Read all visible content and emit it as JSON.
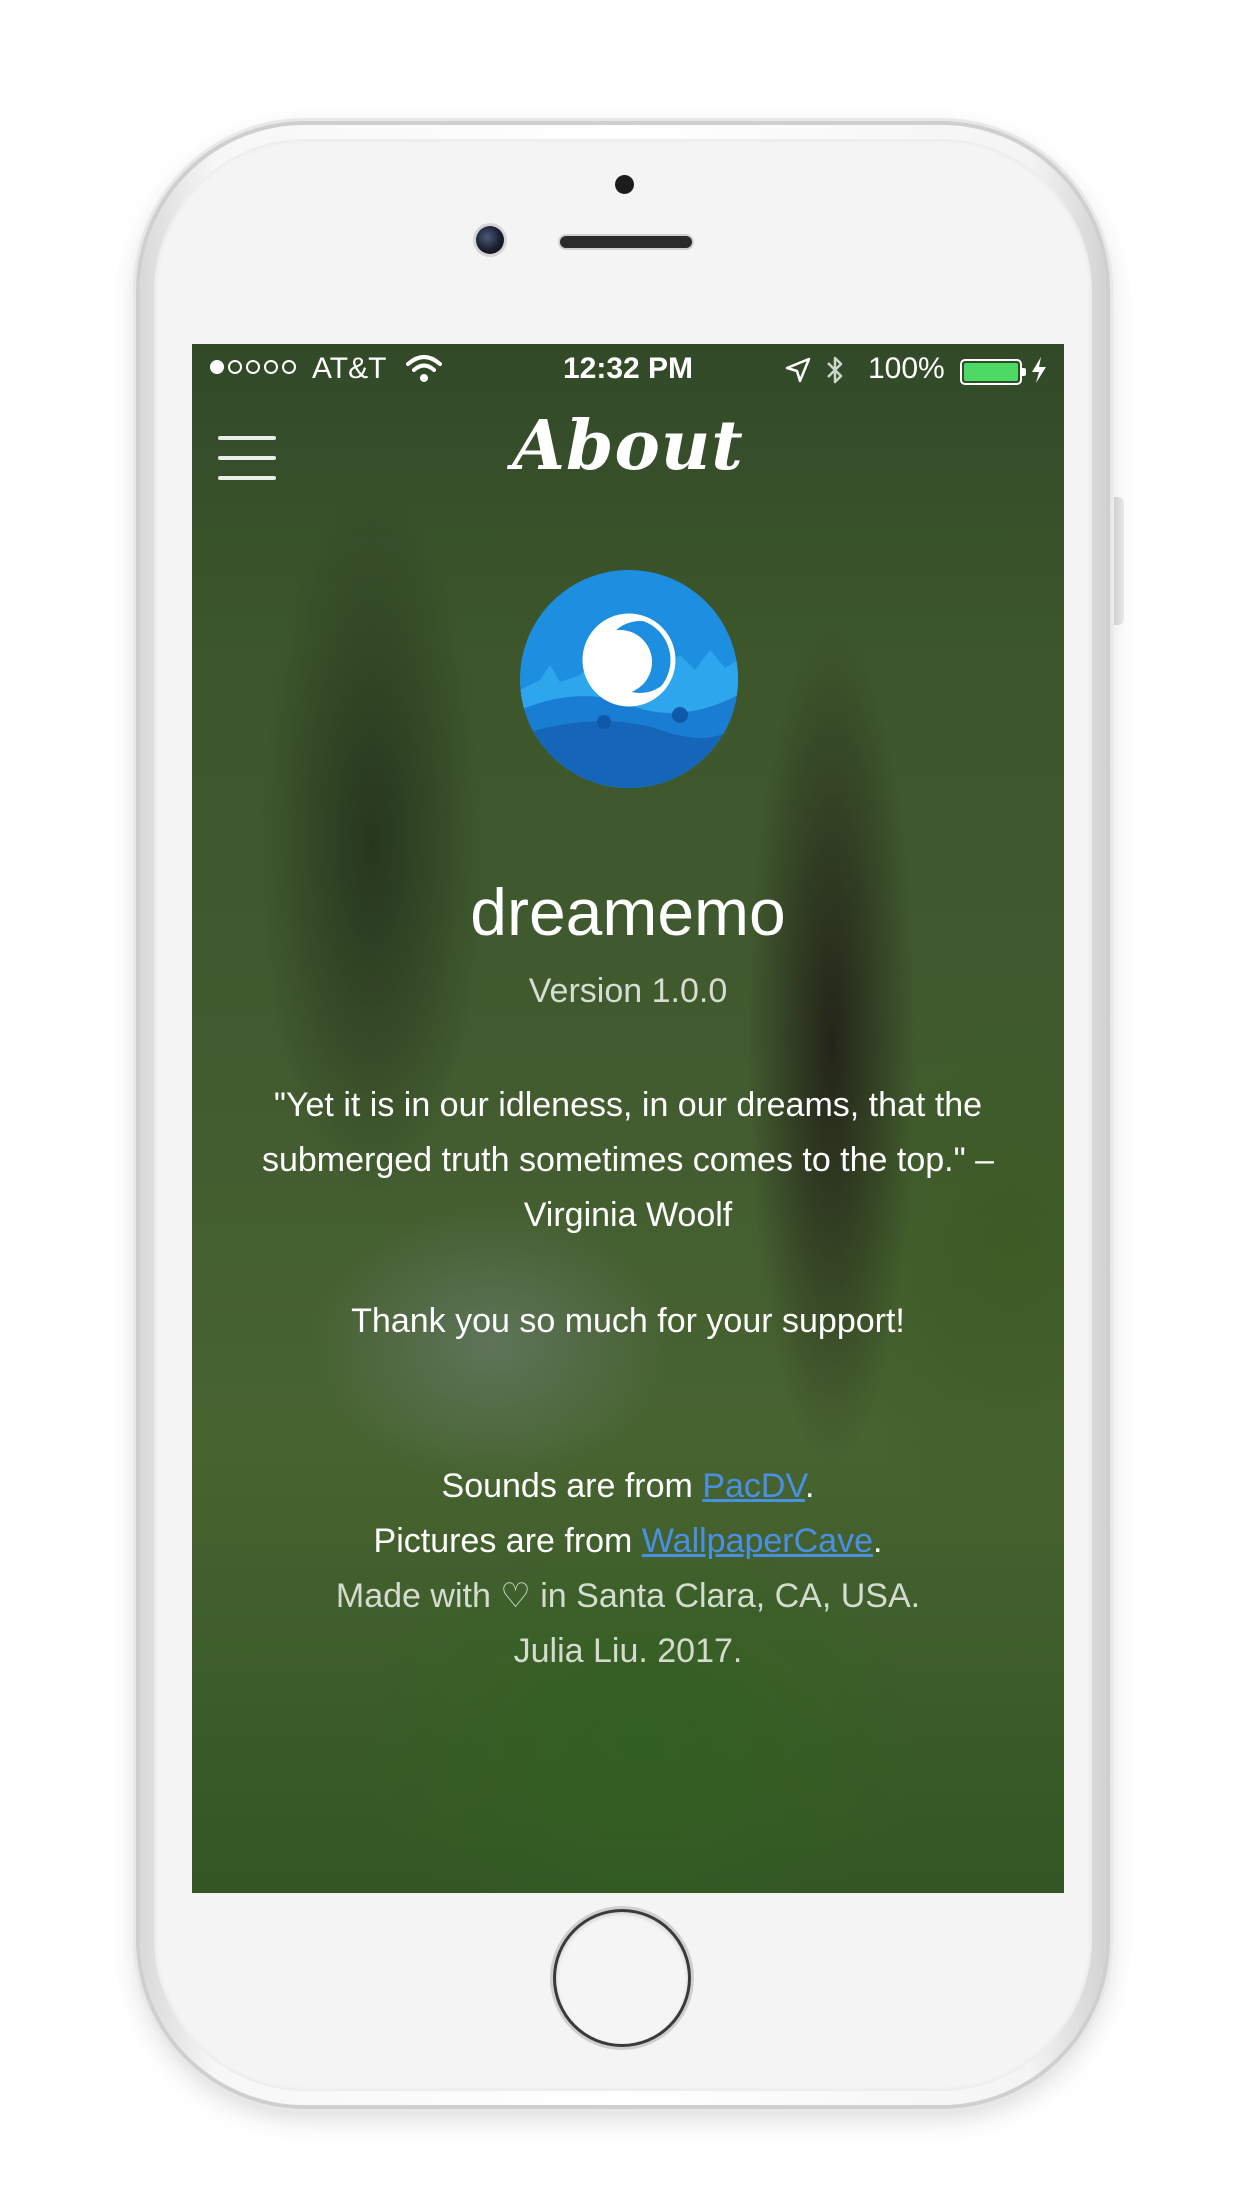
{
  "status_bar": {
    "carrier": "AT&T",
    "time": "12:32 PM",
    "battery_percent": "100%",
    "signal_bars": 1,
    "signal_total": 5,
    "battery_level": 1.0,
    "battery_color": "#4cd964"
  },
  "nav": {
    "title": "About"
  },
  "app": {
    "name": "dreamemo",
    "version": "Version 1.0.0",
    "logo_colors": {
      "sky": "#1e8fe0",
      "hills": "#1565b8",
      "moon": "#ffffff"
    }
  },
  "content": {
    "quote": "\"Yet it is in our idleness, in our dreams, that the submerged truth sometimes comes to the top.\" – Virginia Woolf",
    "thanks": "Thank you so much for your support!"
  },
  "credits": {
    "sounds_prefix": "Sounds are from ",
    "sounds_link": "PacDV",
    "sounds_suffix": ".",
    "pictures_prefix": "Pictures are from ",
    "pictures_link": "WallpaperCave",
    "pictures_suffix": ".",
    "made_with": "Made with ♡ in Santa Clara, CA, USA.",
    "author": "Julia Liu. 2017.",
    "link_color": "#4a90e2"
  }
}
